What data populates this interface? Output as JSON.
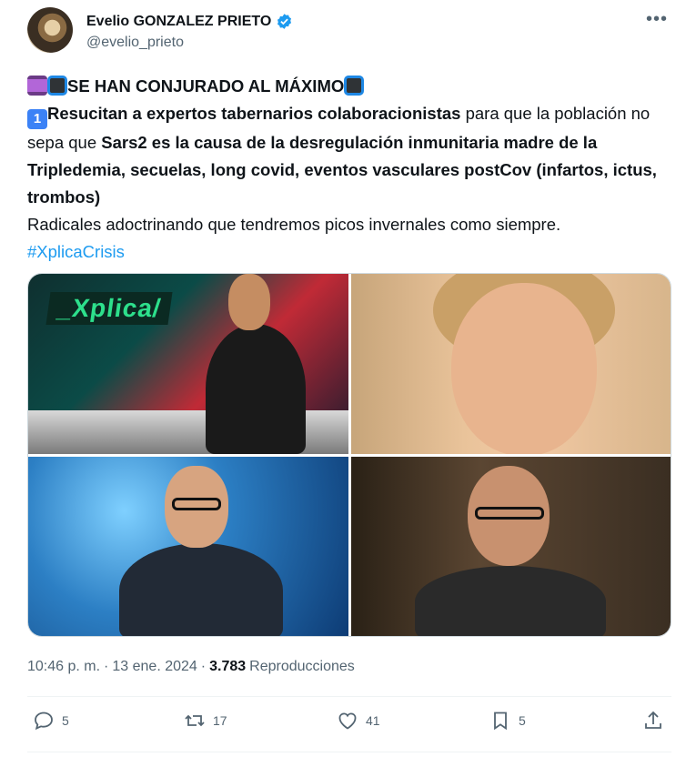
{
  "author": {
    "display_name": "Evelio GONZALEZ PRIETO",
    "handle": "@evelio_prieto",
    "verified": true
  },
  "tweet": {
    "line1_text": "SE HAN CONJURADO AL MÁXIMO",
    "line2_bold1": "Resucitan a expertos tabernarios colaboracionistas",
    "line2_normal1": " para que la población no sepa que ",
    "line2_bold2": "Sars2 es la causa de la desregulación inmunitaria madre de la Tripledemia, secuelas, long covid, eventos vasculares postCov (infartos, ictus, trombos)",
    "line3_text": "Radicales adoctrinando que tendremos picos invernales como siempre.",
    "hashtag": "#XplicaCrisis",
    "keycap": "1"
  },
  "media": {
    "xplica_logo": "_Xplica/"
  },
  "meta": {
    "time": "10:46 p. m.",
    "sep1": "·",
    "date": "13 ene. 2024",
    "sep2": "·",
    "views": "3.783",
    "views_label": "Reproducciones"
  },
  "actions": {
    "replies": "5",
    "retweets": "17",
    "likes": "41",
    "bookmarks": "5"
  },
  "icons": [
    "verified-badge-icon",
    "more-icon",
    "reply-icon",
    "retweet-icon",
    "like-icon",
    "bookmark-icon",
    "share-icon"
  ],
  "colors": {
    "link": "#1d9bf0",
    "secondary": "#536471",
    "verified": "#1d9bf0"
  }
}
